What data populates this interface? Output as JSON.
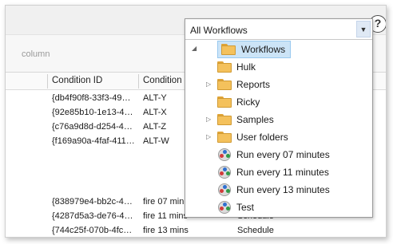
{
  "filter_hint": "column",
  "help_label": "?",
  "grid": {
    "headers": [
      "Condition ID",
      "Condition"
    ],
    "rows": [
      {
        "id": "{db4f90f8-33f3-49…",
        "condition": "ALT-Y",
        "extra": ""
      },
      {
        "id": "{92e85b10-1e13-4…",
        "condition": "ALT-X",
        "extra": ""
      },
      {
        "id": "{c76a9d8d-d254-4…",
        "condition": "ALT-Z",
        "extra": ""
      },
      {
        "id": "{f169a90a-4faf-411…",
        "condition": "ALT-W",
        "extra": ""
      },
      {
        "id": "{838979e4-bb2c-4…",
        "condition": "fire 07 min",
        "extra": ""
      },
      {
        "id": "{4287d5a3-de76-4…",
        "condition": "fire 11 mins",
        "extra": "Schedule"
      },
      {
        "id": "{744c25f-070b-4fc…",
        "condition": "fire 13 mins",
        "extra": "Schedule"
      }
    ]
  },
  "dropdown": {
    "selected_value": "All Workflows",
    "arrow": "▼",
    "tree": {
      "root_expander": "◢",
      "root": "Workflows",
      "expander": "▷",
      "items": [
        {
          "label": "Hulk",
          "type": "folder",
          "expandable": false
        },
        {
          "label": "Reports",
          "type": "folder",
          "expandable": true
        },
        {
          "label": "Ricky",
          "type": "folder",
          "expandable": false
        },
        {
          "label": "Samples",
          "type": "folder",
          "expandable": true
        },
        {
          "label": "User folders",
          "type": "folder",
          "expandable": true
        },
        {
          "label": "Run every 07 minutes",
          "type": "workflow",
          "expandable": false
        },
        {
          "label": "Run every 11 minutes",
          "type": "workflow",
          "expandable": false
        },
        {
          "label": "Run every 13 minutes",
          "type": "workflow",
          "expandable": false
        },
        {
          "label": "Test",
          "type": "workflow",
          "expandable": false
        }
      ]
    }
  }
}
